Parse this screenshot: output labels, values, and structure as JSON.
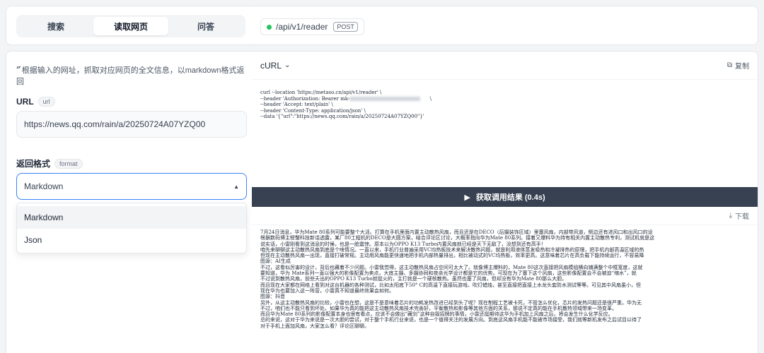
{
  "tabs": [
    {
      "label": "搜索",
      "active": false
    },
    {
      "label": "读取网页",
      "active": true
    },
    {
      "label": "问答",
      "active": false
    }
  ],
  "endpoint": {
    "path": "/api/v1/reader",
    "method": "POST",
    "status_color": "#22c55e"
  },
  "description": "根据输入的网址，抓取对应网页的全文信息，以markdown格式返回",
  "url_field": {
    "label": "URL",
    "tag": "url",
    "value": "https://news.qq.com/rain/a/20250724A07YZQ00"
  },
  "format_field": {
    "label": "返回格式",
    "tag": "format",
    "value": "Markdown",
    "options": [
      "Markdown",
      "Json"
    ]
  },
  "curl": {
    "title": "cURL",
    "copy_label": "复制",
    "lines": [
      "curl --location 'https://metaso.cn/api/v1/reader' \\",
      "--header 'Authorization: Bearer mk-",
      "--header 'Accept: text/plain' \\",
      "--header 'Content-Type: application/json' \\",
      "--data '{\"url\":\"https://news.qq.com/rain/a/20250724A07YZQ00\"}'"
    ],
    "auth_suffix": "\\"
  },
  "run_button": {
    "label": "获取调用结果 (0.4s)"
  },
  "download_label": "下载",
  "result_lines": [
    "7月24日消息，华为Mate 80系列可能要整个大活。打算在手机里面内置主动散热风扇，而且还是在DECO（后摄装饰区域）里塞风扇，内部带风道，侧边还有进风口和出风口的设",
    "根据数码博主螃蟹科技新话透露，某厂80工程机的DECO是大圆方案，结合评论区讨论，大概率指向华为Mate 80系列。接着又爆料华为持有相关内置主动散热专利，测试机就是这",
    "说实话，小雷刚看到这消息的时候，也是一脸震惊。原本以为OPPO K13 Turbo内置风扇就已经是天下无敌了，没想到还有高手！",
    "咱先来聊聊这主动散热风扇到底是个啥情况。一直以来，手机行业普遍采用VC均热板技术来解决散热问题，就是利用液体蒸发吸热和冷凝排热的原理，把手机内部高温区域的热",
    "但现在主动散热风扇一出现，直接打破常规。主动用风扇能更快速地把手机内部热量排出，相比被动式的VC均热板，效率更高。这意味着芯片在高负载下能持续运行，不容易降",
    "图源：AI生成",
    "不过，这看似厉害的设计，背后也藏着不少问题。小雷我觉得，这主动散热风扇占空间可太大了。就像博主爆料的，Mate 80这次直接把风扇模组横向铺满整个中框宽度，这就",
    "要知道，华为 Mate系列一直以强大的影像配置为卖点，大底主摄、多摄协同和夜余光学设计都是它的优势。可现在为了塞下这个风扇，这些影像配置会不会被迫“缩水”，就",
    "不过说到散热风扇，前些天出的OPPO K13 Turbo就挺火的，主打就是一个硬核散热。虽然也塞了风扇，但却没有华为Mate 80那么大胆。",
    "而且现在大家都在网络上看到对这台机器的各种测试，比如太阳底下50° C的高温下直接玩游戏、吹灯蜡烛，甚至直接把直接上水龙头套防水测试等等。可见其中风扇虽小，但",
    "现在华为也要加入这一阵营，小雷真不知道最终效果会如何。",
    "图源：抖音",
    "另外，从这主动散热风扇的比较，小雷也在想，这是不是意味着芯片的功耗发热改进已经到头了呢？现在制程工艺被卡死，不管怎么优化，芯片的发热问题还是很严重。华为无",
    "不过，咱们也不能只看到坏处。如果华为真的能把这主动散热风扇技术完善好，平衡散热和影像等其他方面的关系，那说不定真的能在手机散热领域带来一场变革。",
    "而且华为Mate 80系列的影像配置本身也很有看点，应该不会做出“藏剑”这种自毁招牌的事情，小雷还挺期待这华为手机加上风扇之后，将会发生什么化学反应。",
    "总的来说，这对于华为来说是一次大胆的尝试，对于整个手机行业来说，也是一个值得关注的发展方向。到底这风扇手机能不能被市场接受，我们就等新机发布之后试目以待了",
    "对于手机上面加风扇，大家怎么看？评论区聊聊。"
  ]
}
